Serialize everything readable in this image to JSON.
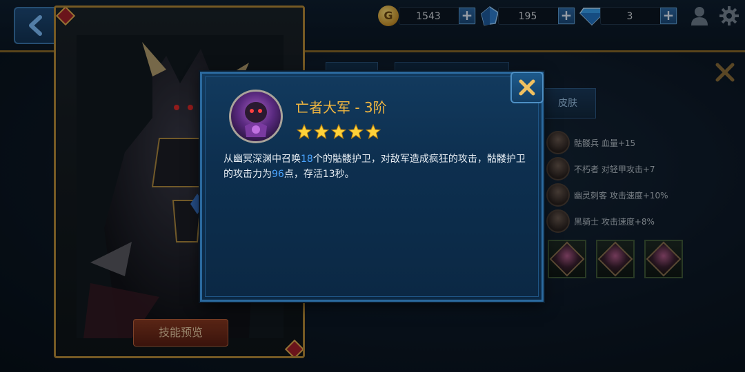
{
  "resources": {
    "gold": "1543",
    "crystal": "195",
    "diamond": "3"
  },
  "right_panel": {
    "skin_tab": "皮肤",
    "bonuses": [
      {
        "unit": "骷髅兵",
        "effect": "血量+15"
      },
      {
        "unit": "不朽者",
        "effect": "对轻甲攻击+7"
      },
      {
        "unit": "幽灵刺客",
        "effect": "攻击速度+10%"
      },
      {
        "unit": "黑骑士",
        "effect": "攻击速度+8%"
      }
    ]
  },
  "hero": {
    "preview_button": "技能预览"
  },
  "modal": {
    "title": "亡者大军 - 3阶",
    "stars": 5,
    "desc": {
      "p1": "从幽冥深渊中召唤",
      "n1": "18",
      "p2": "个的骷髅护卫，对敌军造成疯狂的攻击，骷髅护卫的攻击力为",
      "n2": "96",
      "p3": "点，存活13秒。"
    }
  },
  "colors": {
    "title_gold": "#f0b640",
    "highlight_blue": "#4aa4ff"
  }
}
